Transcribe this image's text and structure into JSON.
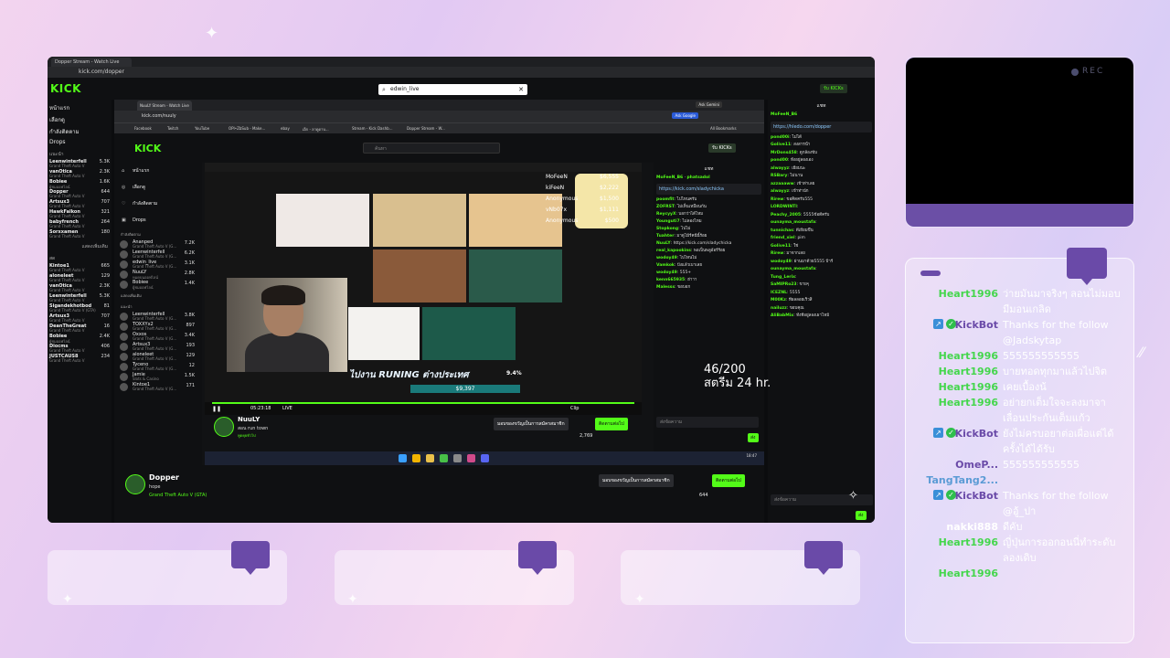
{
  "outer_browser": {
    "tab_title": "Dopper Stream - Watch Live",
    "url": "kick.com/dopper",
    "search_value": "edwin_live",
    "get_kicks": "รับ KICKs"
  },
  "outer_nav": {
    "home": "หน้าแรก",
    "browse": "เลือกดู",
    "following": "กำลังติดตาม",
    "drops": "Drops",
    "section_recommended": "แนะนำ",
    "section_live": "สด",
    "show_more": "แสดงเพิ่มเติม",
    "channels": [
      {
        "name": "Leenwinterfell",
        "game": "Grand Theft Auto V",
        "viewers": "5.3K"
      },
      {
        "name": "vanOtica",
        "game": "Grand Theft Auto V",
        "viewers": "2.3K"
      },
      {
        "name": "Bobiee",
        "game": "ผู้ชมออฟไลน์",
        "viewers": "1.6K"
      },
      {
        "name": "Dopper",
        "game": "Grand Theft Auto V",
        "viewers": "644"
      },
      {
        "name": "Artsux3",
        "game": "Grand Theft Auto V",
        "viewers": "707"
      },
      {
        "name": "HawkFalkon",
        "game": "Grand Theft Auto V",
        "viewers": "321"
      },
      {
        "name": "babyfrench",
        "game": "Grand Theft Auto V",
        "viewers": "264"
      },
      {
        "name": "Sorxxamen",
        "game": "Grand Theft Auto V",
        "viewers": "180"
      }
    ],
    "channels2": [
      {
        "name": "Kintoe1",
        "game": "Grand Theft Auto V",
        "viewers": "665"
      },
      {
        "name": "aloneleet",
        "game": "Grand Theft Auto V",
        "viewers": "129"
      },
      {
        "name": "vanOtica",
        "game": "Grand Theft Auto V",
        "viewers": "2.3K"
      },
      {
        "name": "Leenwinterfell",
        "game": "Grand Theft Auto V",
        "viewers": "5.3K"
      },
      {
        "name": "Sigandekhotbod",
        "game": "Grand Theft Auto V (GTA)",
        "viewers": "81"
      },
      {
        "name": "Artsux3",
        "game": "Grand Theft Auto V",
        "viewers": "707"
      },
      {
        "name": "DeanTheGreat",
        "game": "Grand Theft Auto V",
        "viewers": "16"
      },
      {
        "name": "Bobiee",
        "game": "ผู้ชมออฟไลน์",
        "viewers": "2.4K"
      },
      {
        "name": "Diocms",
        "game": "Grand Theft Auto V",
        "viewers": "406"
      },
      {
        "name": "JUSTCAUS8",
        "game": "Grand Theft Auto V",
        "viewers": "234"
      }
    ]
  },
  "inner_browser": {
    "tab_title": "NuuLY Stream - Watch Live",
    "url": "kick.com/nuuly",
    "ask_google": "Ask Google",
    "ask_gemini": "Ask Gemini",
    "bookmarks": [
      "Facebook",
      "Twitch",
      "YouTube",
      "OPI•ZbSub - Make...",
      "ebay",
      "เอ็ก - ลาดูดาบ...",
      "Stream - Kick Dashb...",
      "Dopper Stream - W..."
    ],
    "all_bookmarks": "All Bookmarks",
    "search_placeholder": "ค้นหา",
    "get_kicks": "รับ KICKs",
    "nav": {
      "home": "หน้าแรก",
      "browse": "เลือกดู",
      "following": "กำลังติดตาม",
      "drops": "Drops",
      "following_header": "กำลังติดตาม",
      "recommended_header": "แนะนำ",
      "show_more": "แสดงเพิ่มเติม"
    },
    "channels": [
      {
        "name": "Ananped",
        "game": "Grand Theft Auto V (G...",
        "viewers": "7.2K"
      },
      {
        "name": "Leenwinterfell",
        "game": "Grand Theft Auto V (G...",
        "viewers": "6.2K"
      },
      {
        "name": "edwin_live",
        "game": "Grand Theft Auto V (G...",
        "viewers": "3.1K"
      },
      {
        "name": "NuuLY",
        "game": "หมดบนออฟไลน์",
        "viewers": "2.8K"
      },
      {
        "name": "Bobiee",
        "game": "ผู้ชมออฟไลน์",
        "viewers": "1.4K"
      }
    ],
    "channels2": [
      {
        "name": "Leenwinterfell",
        "game": "Grand Theft Auto V (G...",
        "viewers": "3.8K"
      },
      {
        "name": "TOXXYx2",
        "game": "Grand Theft Auto V (G...",
        "viewers": "897"
      },
      {
        "name": "Oxxos",
        "game": "Grand Theft Auto V (G...",
        "viewers": "3.4K"
      },
      {
        "name": "Artsux3",
        "game": "Grand Theft Auto V (G...",
        "viewers": "193"
      },
      {
        "name": "aloneleet",
        "game": "Grand Theft Auto V (G...",
        "viewers": "129"
      },
      {
        "name": "Tyceno",
        "game": "Grand Theft Auto V (G...",
        "viewers": "12"
      },
      {
        "name": "Jamie",
        "game": "Slots & Casino",
        "viewers": "1.5K"
      },
      {
        "name": "Kintoe1",
        "game": "Grand Theft Auto V (G...",
        "viewers": "171"
      }
    ],
    "video": {
      "overlay_text": "ไปงาน RUNING ต่างประเทศ",
      "percent": "9.4%",
      "score": "$9,397",
      "time": "05:23:18",
      "live": "LIVE",
      "clip": "Clip",
      "leaderboard": [
        {
          "name": "MoFeeN",
          "value": "$6,555"
        },
        {
          "name": "kiFeeN",
          "value": "$2,222"
        },
        {
          "name": "Anonymous",
          "value": "$1,500"
        },
        {
          "name": "vNb07x",
          "value": "$1,111"
        },
        {
          "name": "Anonymous",
          "value": "$500"
        }
      ]
    },
    "streamer": {
      "name": "NuuLY",
      "title": "สอน run town",
      "category": "พูดคุยทั่วไป",
      "language": "Thai",
      "viewers": "2,769",
      "promo": "มอบของขวัญเป็นการสมัครสมาชิก",
      "follow": "ติดตามต่อไป",
      "timestamp": "18:47"
    },
    "chat": {
      "header": "แชท",
      "top_gifters": [
        "MoFeeN_B6",
        "phatsadol"
      ],
      "pinned_link": "https://kick.com/sladychicka",
      "messages": [
        {
          "user": "poomfit",
          "text": "ไปไหนครับ"
        },
        {
          "user": "ZOFRST",
          "text": "ไม่เห็นเหมือนกัน"
        },
        {
          "user": "ReycyyX",
          "text": "บอกว่าได้ไหม"
        },
        {
          "user": "Younguti7",
          "text": "ไม่ลองไหม"
        },
        {
          "user": "Stopkong",
          "text": "ไปไม่"
        },
        {
          "user": "Tuahter",
          "text": "มาดูไม้ร์คนีนี้ร้อย"
        },
        {
          "user": "NuuLY",
          "text": "https://kick.com/sladychicka"
        },
        {
          "user": "real_kapookins",
          "text": "พอเป็นพลูอ้อร์ร้อย"
        },
        {
          "user": "wodoy49",
          "text": "ไปไหนไม่"
        },
        {
          "user": "Vamkok",
          "text": "ปังแล้วเบาเลย"
        },
        {
          "user": "wodoy49",
          "text": "555+"
        },
        {
          "user": "kenn665935",
          "text": "ฮ่าาา"
        },
        {
          "user": "Malesss",
          "text": "ขอบอก"
        }
      ],
      "input_placeholder": "ส่งข้อความ",
      "points": "0",
      "send": "ส่ง"
    }
  },
  "outer_stream": {
    "name": "Dopper",
    "title": "hope",
    "category": "Grand Theft Auto V (GTA)",
    "language": "Thai",
    "viewers": "644",
    "promo": "มอบของขวัญเป็นการสมัครสมาชิก",
    "follow": "ติดตามต่อไป"
  },
  "outer_chat": {
    "header": "แชท",
    "top_gifter": "MoFeeN_B6",
    "pinned_link": "https://hledo.com/dopper",
    "messages": [
      {
        "user": "pond00i",
        "text": "ไม่ได้"
      },
      {
        "user": "Golive11",
        "text": "สงสารน้ำ"
      },
      {
        "user": "MrDons458",
        "text": "ดูกล้องขับ"
      },
      {
        "user": "pond00",
        "text": "ทั้งอยู่ลองเอง"
      },
      {
        "user": "alwayyz",
        "text": "เยี่ยมนะ"
      },
      {
        "user": "RSBary",
        "text": "ไม่นาน"
      },
      {
        "user": "azzaaaww",
        "text": "เข้าท่าเลย"
      },
      {
        "user": "alwayyz",
        "text": "เข้าท่านัก"
      },
      {
        "user": "Rirew",
        "text": "ขอคิดครับ555"
      },
      {
        "user": "LORDWINTI",
        "text": ""
      },
      {
        "user": "Peachy_2005",
        "text": "5555ข้อดีครับ"
      },
      {
        "user": "ounayma_moustafa",
        "text": ""
      },
      {
        "user": "tunnichas",
        "text": "ดีเยี่ยมขึ้น"
      },
      {
        "user": "friend_xiel",
        "text": "pim"
      },
      {
        "user": "Golive11",
        "text": "ใช่"
      },
      {
        "user": "Rirew",
        "text": "มาจากเลย"
      },
      {
        "user": "wodoy49",
        "text": "ผ่านมาด้วย5555 ป้าร์"
      },
      {
        "user": "ounayma_moustafa",
        "text": ""
      },
      {
        "user": "Tung_Lerix",
        "text": ""
      },
      {
        "user": "SaMIPRo23",
        "text": "ขายๆ"
      },
      {
        "user": "ICEZNL",
        "text": "5555"
      },
      {
        "user": "M00Kz",
        "text": "ที่ผลลอยเร็วสิ"
      },
      {
        "user": "nailuzz",
        "text": "ขอบคุณ"
      },
      {
        "user": "AliBabMix",
        "text": "ทั้งที่อยู่ลองเผาไหม้"
      }
    ],
    "input_placeholder": "ส่งข้อความ",
    "points": "0",
    "send": "ส่ง"
  },
  "goal": {
    "progress": "46/200",
    "label": "สตรีม 24 hr."
  },
  "webcam": {
    "rec": "REC"
  },
  "chat_overlay": {
    "messages": [
      {
        "user": "Heart1996",
        "text": "ว่ายมันมาจริงๆ ลอนไม่มอบมีมอนเกลิด",
        "bot": false,
        "user_color": "#44d64c"
      },
      {
        "user": "KickBot",
        "text": "Thanks for the follow @Jadskytap",
        "bot": true,
        "user_color": "#6a4aa8"
      },
      {
        "user": "Heart1996",
        "text": "555555555555",
        "bot": false,
        "user_color": "#44d64c"
      },
      {
        "user": "Heart1996",
        "text": "บายทอดทุกมาแล้วไปจิต",
        "bot": false,
        "user_color": "#44d64c"
      },
      {
        "user": "Heart1996",
        "text": "เคยเบื้องน้",
        "bot": false,
        "user_color": "#44d64c"
      },
      {
        "user": "Heart1996",
        "text": "อย่ายกเต็มใจจะลงมาจาเลื่อนประกันเต็มแก้ว",
        "bot": false,
        "user_color": "#44d64c"
      },
      {
        "user": "KickBot",
        "text": "ยังไม่ครบอยาต่อเผื่อแต่ได้ครั้งได้ได้รับ",
        "bot": true,
        "user_color": "#6a4aa8"
      },
      {
        "user": "OmeP...",
        "text": "555555555555",
        "bot": false,
        "user_color": "#6a4aa8"
      },
      {
        "user": "TangTang2...",
        "text": "",
        "bot": false,
        "user_color": "#5b9bd5"
      },
      {
        "user": "KickBot",
        "text": "Thanks for the follow @อู้_ปา",
        "bot": true,
        "user_color": "#6a4aa8"
      },
      {
        "user": "nakki888",
        "text": "ดีคับ",
        "bot": false,
        "user_color": "#ffffff"
      },
      {
        "user": "Heart1996",
        "text": "ญี่ปุ่นการออกอนนี่ทำระดับลองเดิบ",
        "bot": false,
        "user_color": "#44d64c"
      },
      {
        "user": "Heart1996",
        "text": "",
        "bot": false,
        "user_color": "#44d64c"
      }
    ]
  },
  "colors": {
    "kick_green": "#53fc18",
    "accent_purple": "#6a4aa8"
  }
}
